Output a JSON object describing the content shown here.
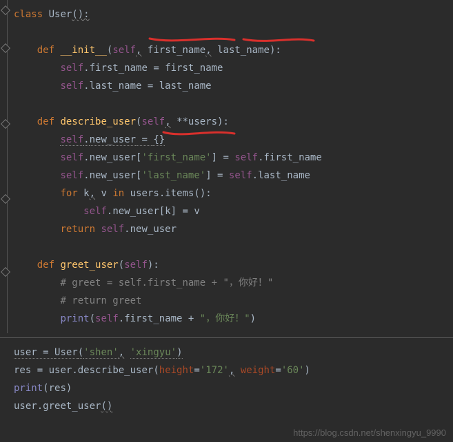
{
  "code": {
    "l1_class": "class",
    "l1_name": "User",
    "l1_paren": "():",
    "l3_def": "def",
    "l3_fn": "__init__",
    "l3_self": "self",
    "l3_p1": "first_name",
    "l3_p2": "last_name",
    "l4_self": "self",
    "l4_attr": "first_name",
    "l4_rhs": "first_name",
    "l5_self": "self",
    "l5_attr": "last_name",
    "l5_rhs": "last_name",
    "l7_def": "def",
    "l7_fn": "describe_user",
    "l7_self": "self",
    "l7_kw": "**users",
    "l8_self": "self",
    "l8_attr": "new_user",
    "l8_rhs": "{}",
    "l9_self": "self",
    "l9_attr": "new_user",
    "l9_key": "'first_name'",
    "l9_self2": "self",
    "l9_rhs": "first_name",
    "l10_self": "self",
    "l10_attr": "new_user",
    "l10_key": "'last_name'",
    "l10_self2": "self",
    "l10_rhs": "last_name",
    "l11_for": "for",
    "l11_k": "k",
    "l11_v": "v",
    "l11_in": "in",
    "l11_obj": "users",
    "l11_m": "items",
    "l12_self": "self",
    "l12_attr": "new_user",
    "l12_k": "k",
    "l12_v": "v",
    "l13_return": "return",
    "l13_self": "self",
    "l13_attr": "new_user",
    "l15_def": "def",
    "l15_fn": "greet_user",
    "l15_self": "self",
    "l16_cmt": "# greet = self.first_name + \"，你好！\"",
    "l17_cmt": "# return greet",
    "l18_print": "print",
    "l18_self": "self",
    "l18_attr": "first_name",
    "l18_str": "\"，你好！\"",
    "u1_var": "user",
    "u1_cls": "User",
    "u1_a": "'shen'",
    "u1_b": "'xingyu'",
    "u2_var": "res",
    "u2_obj": "user",
    "u2_m": "describe_user",
    "u2_k1": "height",
    "u2_v1": "'172'",
    "u2_k2": "weight",
    "u2_v2": "'60'",
    "u3_print": "print",
    "u3_arg": "res",
    "u4_obj": "user",
    "u4_m": "greet_user"
  },
  "watermark": "https://blog.csdn.net/shenxingyu_9990"
}
